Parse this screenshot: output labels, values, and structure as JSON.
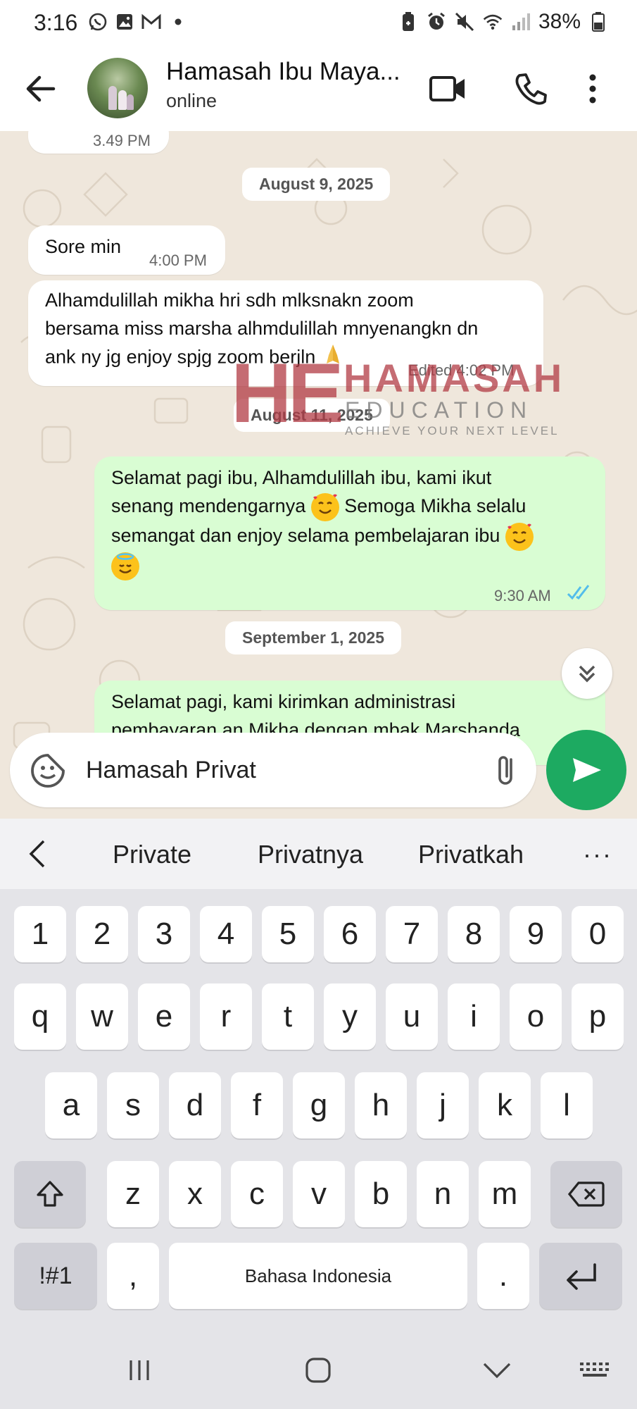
{
  "status_bar": {
    "time": "3:16",
    "battery": "38%",
    "left_icons": [
      "whatsapp-icon",
      "gallery-icon",
      "gmail-icon",
      "dot-icon"
    ],
    "right_icons": [
      "battery-saver-icon",
      "alarm-icon",
      "mute-icon",
      "wifi-icon",
      "signal-icon",
      "battery-icon"
    ]
  },
  "header": {
    "title": "Hamasah Ibu Maya...",
    "subtitle": "online"
  },
  "chat": {
    "partial_time": "3.49 PM",
    "date1": "August 9, 2025",
    "msg1": {
      "text": "Sore min",
      "time": "4:00 PM"
    },
    "msg2": {
      "line1": "Alhamdulillah mikha hri sdh mlksnakn zoom",
      "line2": "bersama miss marsha alhmdulillah mnyenangkn dn",
      "line3": "ank ny jg enjoy spjg zoom berjln",
      "edited_time": "Edited 4:02 PM"
    },
    "date2": "August 11, 2025",
    "msg3": {
      "line1": "Selamat pagi ibu, Alhamdulillah ibu, kami ikut",
      "line2a": "senang mendengarnya",
      "line2b": "Semoga Mikha selalu",
      "line3": "semangat dan enjoy selama pembelajaran ibu",
      "time": "9:30 AM"
    },
    "date3": "September 1, 2025",
    "msg4": {
      "line1": "Selamat pagi, kami kirimkan administrasi",
      "line2": "pembayaran an Mikha dengan mbak Marshanda"
    }
  },
  "watermark": {
    "mark": "HE",
    "name": "HAMASAH",
    "sub": "EDUCATION",
    "tagline": "ACHIEVE YOUR NEXT LEVEL"
  },
  "composer": {
    "value": "Hamasah Privat"
  },
  "suggestions": [
    "Private",
    "Privatnya",
    "Privatkah"
  ],
  "suggestions_more": "···",
  "keyboard": {
    "numbers": [
      "1",
      "2",
      "3",
      "4",
      "5",
      "6",
      "7",
      "8",
      "9",
      "0"
    ],
    "row1": [
      "q",
      "w",
      "e",
      "r",
      "t",
      "y",
      "u",
      "i",
      "o",
      "p"
    ],
    "row2": [
      "a",
      "s",
      "d",
      "f",
      "g",
      "h",
      "j",
      "k",
      "l"
    ],
    "row3": [
      "z",
      "x",
      "c",
      "v",
      "b",
      "n",
      "m"
    ],
    "symbols": "!#1",
    "comma": ",",
    "space": "Bahasa Indonesia",
    "period": "."
  },
  "colors": {
    "accent": "#1daa61",
    "outgoing_bubble": "#d9fdd3",
    "chat_bg": "#efe7dc",
    "read_ticks": "#53bdeb",
    "watermark": "#b23b45"
  }
}
